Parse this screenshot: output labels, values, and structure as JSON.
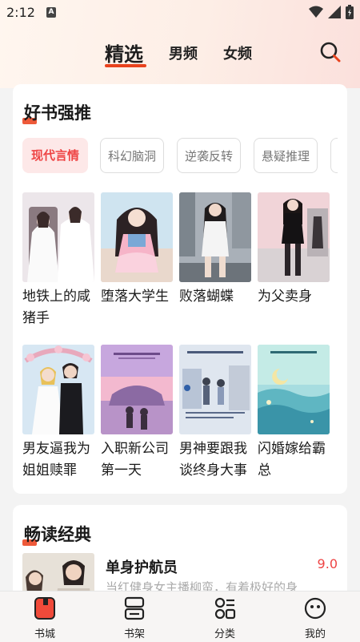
{
  "status": {
    "time": "2:12",
    "sim_label": "A"
  },
  "top_tabs": {
    "active": "精选",
    "male": "男频",
    "female": "女频"
  },
  "recommend": {
    "title": "好书强推",
    "filters": [
      "现代言情",
      "科幻脑洞",
      "逆袭反转",
      "悬疑推理"
    ],
    "books": [
      {
        "title": "地铁上的咸猪手"
      },
      {
        "title": "堕落大学生"
      },
      {
        "title": "败落蝴蝶"
      },
      {
        "title": "为父卖身"
      },
      {
        "title": "男友逼我为姐姐赎罪"
      },
      {
        "title": "入职新公司第一天"
      },
      {
        "title": "男神要跟我谈终身大事"
      },
      {
        "title": "闪婚嫁给霸总"
      }
    ]
  },
  "classics": {
    "title": "畅读经典",
    "item": {
      "title": "单身护航员",
      "score": "9.0",
      "desc": "当红健身女主播柳蛮，有着极好的身"
    }
  },
  "tabbar": {
    "items": [
      {
        "label": "书城",
        "icon": "bookstore-icon"
      },
      {
        "label": "书架",
        "icon": "bookshelf-icon"
      },
      {
        "label": "分类",
        "icon": "category-icon"
      },
      {
        "label": "我的",
        "icon": "profile-icon"
      }
    ]
  },
  "colors": {
    "accent": "#e8421d",
    "chip_active_bg": "#fde8e8",
    "score": "#ee4444"
  }
}
